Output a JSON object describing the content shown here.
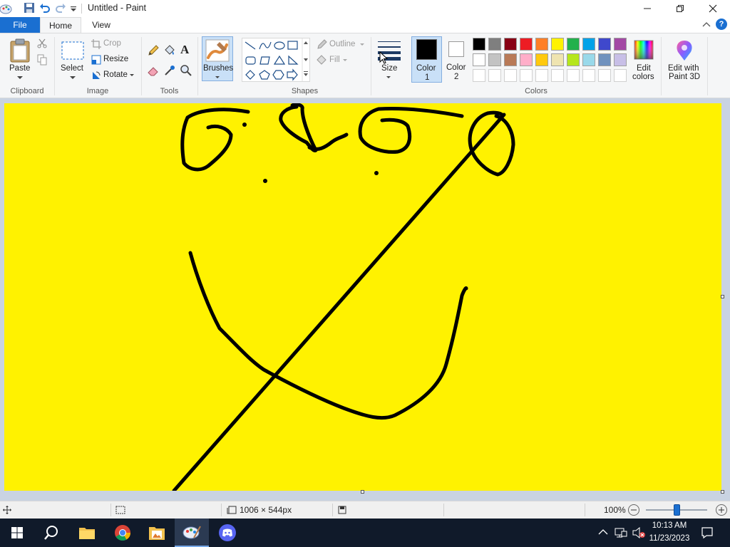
{
  "window": {
    "title": "Untitled - Paint"
  },
  "tabs": {
    "file": "File",
    "home": "Home",
    "view": "View"
  },
  "ribbon": {
    "clipboard": {
      "paste": "Paste",
      "group": "Clipboard"
    },
    "image": {
      "select": "Select",
      "crop": "Crop",
      "resize": "Resize",
      "rotate": "Rotate",
      "group": "Image"
    },
    "tools": {
      "group": "Tools"
    },
    "brushes": {
      "label": "Brushes"
    },
    "shapes": {
      "outline": "Outline",
      "fill": "Fill",
      "group": "Shapes"
    },
    "size": {
      "label": "Size"
    },
    "colors": {
      "color1_line1": "Color",
      "color1_line2": "1",
      "color2_line1": "Color",
      "color2_line2": "2",
      "edit_colors_line1": "Edit",
      "edit_colors_line2": "colors",
      "edit_paint3d_line1": "Edit with",
      "edit_paint3d_line2": "Paint 3D",
      "group": "Colors",
      "color1_value": "#000000",
      "color2_value": "#ffffff",
      "palette_row1": [
        "#000000",
        "#7f7f7f",
        "#880015",
        "#ed1c24",
        "#ff7f27",
        "#fff200",
        "#22b14c",
        "#00a2e8",
        "#3f48cc",
        "#a349a4"
      ],
      "palette_row2": [
        "#ffffff",
        "#c3c3c3",
        "#b97a57",
        "#ffaec9",
        "#ffc90e",
        "#efe4b0",
        "#b5e61d",
        "#99d9ea",
        "#7092be",
        "#c8bfe7"
      ]
    }
  },
  "canvas": {
    "background": "#fff200",
    "stroke": "#000000"
  },
  "status": {
    "dimensions": "1006 × 544px",
    "zoom": "100%",
    "zoom_level_percent": 100
  },
  "taskbar": {
    "time": "10:13 AM",
    "date": "11/23/2023",
    "apps": [
      "start-icon",
      "search-icon",
      "file-explorer-icon",
      "chrome-icon",
      "photos-icon",
      "paint-icon",
      "discord-icon"
    ]
  }
}
